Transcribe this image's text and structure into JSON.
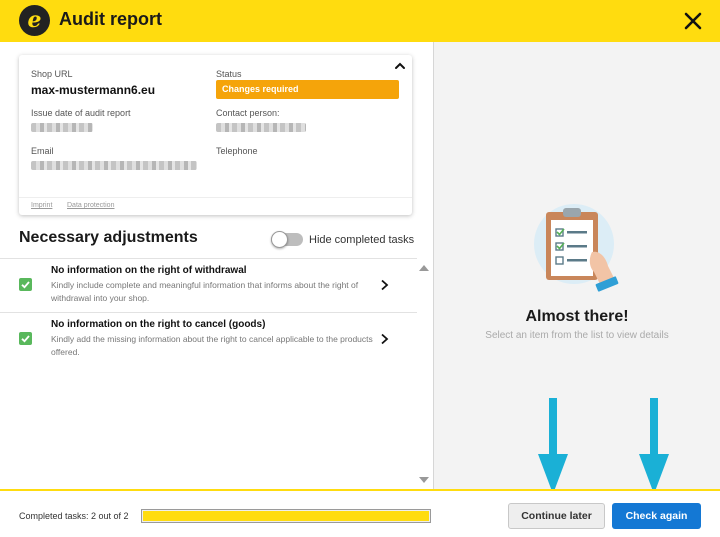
{
  "header": {
    "title": "Audit report",
    "logo_letter": "e",
    "close_icon": "close-icon"
  },
  "card": {
    "shop_url_label": "Shop URL",
    "shop_url_value": "max-mustermann6.eu",
    "status_label": "Status",
    "status_value": "Changes required",
    "issue_date_label": "Issue date of audit report",
    "contact_label": "Contact person:",
    "email_label": "Email",
    "telephone_label": "Telephone",
    "imprint_link": "Imprint",
    "data_protection_link": "Data protection"
  },
  "adjustments": {
    "title": "Necessary adjustments",
    "hide_completed_label": "Hide completed tasks",
    "hide_completed_on": false,
    "items": [
      {
        "title": "No information on the right of withdrawal",
        "description": "Kindly include complete and meaningful information that informs about the right of withdrawal into your shop.",
        "completed": true
      },
      {
        "title": "No information on the right to cancel (goods)",
        "description": "Kindly add the missing information about the right to cancel applicable to the products offered.",
        "completed": true
      }
    ]
  },
  "detail": {
    "heading": "Almost there!",
    "subtext": "Select an item from the list to view details",
    "illustration_icon": "clipboard-checklist-icon"
  },
  "footer": {
    "progress_label": "Completed tasks: 2 out of 2",
    "progress_fraction": 1.0,
    "continue_label": "Continue later",
    "check_label": "Check again"
  },
  "colors": {
    "brand_yellow": "#ffdc0f",
    "status_orange": "#f5a40a",
    "check_green": "#59b85c",
    "primary_blue": "#1478d4",
    "annotation_arrow": "#1ab0d6"
  }
}
